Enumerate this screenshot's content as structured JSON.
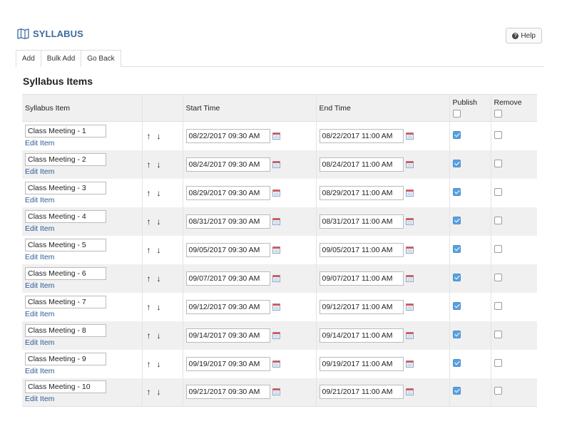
{
  "header": {
    "title": "SYLLABUS",
    "help_label": "Help"
  },
  "nav": {
    "tabs": [
      "Add",
      "Bulk Add",
      "Go Back"
    ]
  },
  "page_title": "Syllabus Items",
  "columns": {
    "item": "Syllabus Item",
    "start": "Start Time",
    "end": "End Time",
    "publish": "Publish",
    "remove": "Remove"
  },
  "edit_label": "Edit Item",
  "arrows": {
    "up": "↑",
    "down": "↓"
  },
  "items": [
    {
      "name": "Class Meeting - 1",
      "start": "08/22/2017 09:30 AM",
      "end": "08/22/2017 11:00 AM",
      "publish": true,
      "remove": false
    },
    {
      "name": "Class Meeting - 2",
      "start": "08/24/2017 09:30 AM",
      "end": "08/24/2017 11:00 AM",
      "publish": true,
      "remove": false
    },
    {
      "name": "Class Meeting - 3",
      "start": "08/29/2017 09:30 AM",
      "end": "08/29/2017 11:00 AM",
      "publish": true,
      "remove": false
    },
    {
      "name": "Class Meeting - 4",
      "start": "08/31/2017 09:30 AM",
      "end": "08/31/2017 11:00 AM",
      "publish": true,
      "remove": false
    },
    {
      "name": "Class Meeting - 5",
      "start": "09/05/2017 09:30 AM",
      "end": "09/05/2017 11:00 AM",
      "publish": true,
      "remove": false
    },
    {
      "name": "Class Meeting - 6",
      "start": "09/07/2017 09:30 AM",
      "end": "09/07/2017 11:00 AM",
      "publish": true,
      "remove": false
    },
    {
      "name": "Class Meeting - 7",
      "start": "09/12/2017 09:30 AM",
      "end": "09/12/2017 11:00 AM",
      "publish": true,
      "remove": false
    },
    {
      "name": "Class Meeting - 8",
      "start": "09/14/2017 09:30 AM",
      "end": "09/14/2017 11:00 AM",
      "publish": true,
      "remove": false
    },
    {
      "name": "Class Meeting - 9",
      "start": "09/19/2017 09:30 AM",
      "end": "09/19/2017 11:00 AM",
      "publish": true,
      "remove": false
    },
    {
      "name": "Class Meeting - 10",
      "start": "09/21/2017 09:30 AM",
      "end": "09/21/2017 11:00 AM",
      "publish": true,
      "remove": false
    }
  ],
  "colors": {
    "brand": "#3b6aa0",
    "link": "#2a5d9a",
    "checked": "#5aa0e0"
  }
}
